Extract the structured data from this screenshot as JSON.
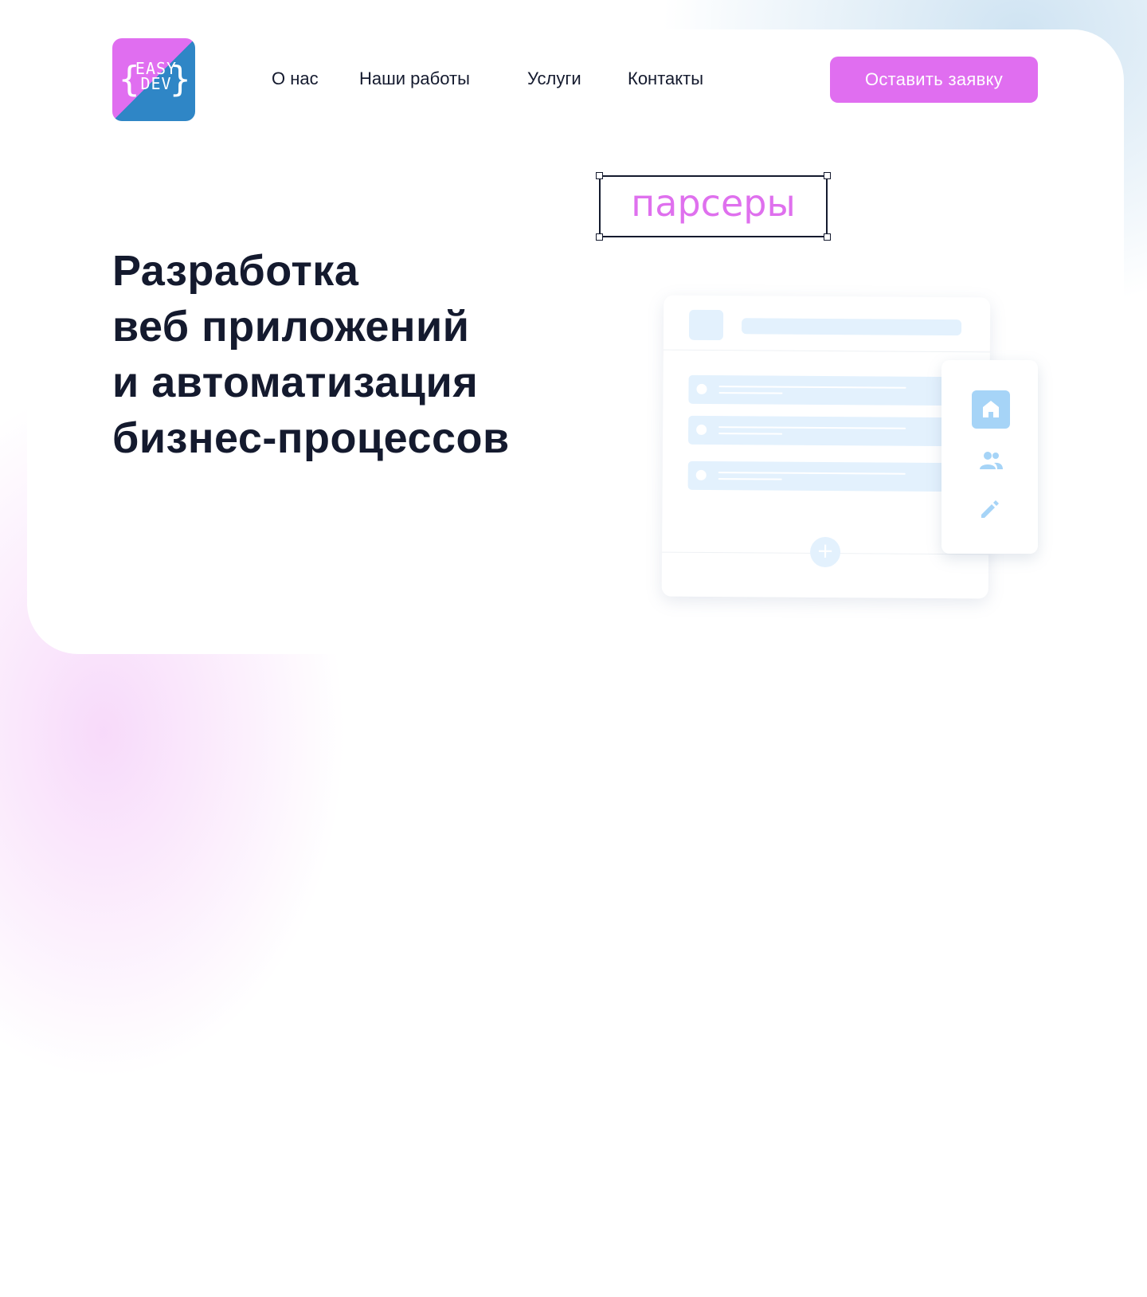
{
  "logo": {
    "line1": "EASY",
    "line2": "DEV",
    "color_pink": "#e06ef0",
    "color_blue": "#2f86c6"
  },
  "nav": {
    "items": [
      {
        "label": "О нас"
      },
      {
        "label": "Наши работы"
      },
      {
        "label": "Услуги"
      },
      {
        "label": "Контакты"
      }
    ]
  },
  "header": {
    "cta_label": "Оставить заявку"
  },
  "hero": {
    "title_lines": [
      "Разработка",
      "веб приложений",
      "и автоматизация",
      "бизнес-процессов"
    ],
    "highlight_word": "парсеры"
  },
  "illustration": {
    "panel_icons": [
      "home-icon",
      "users-icon",
      "pencil-icon"
    ],
    "add_icon": "plus-icon",
    "accent_light": "#e3f1fd",
    "accent_icon": "#a6d4f7"
  },
  "colors": {
    "text_dark": "#141a2e",
    "accent_pink": "#e06ef0"
  }
}
